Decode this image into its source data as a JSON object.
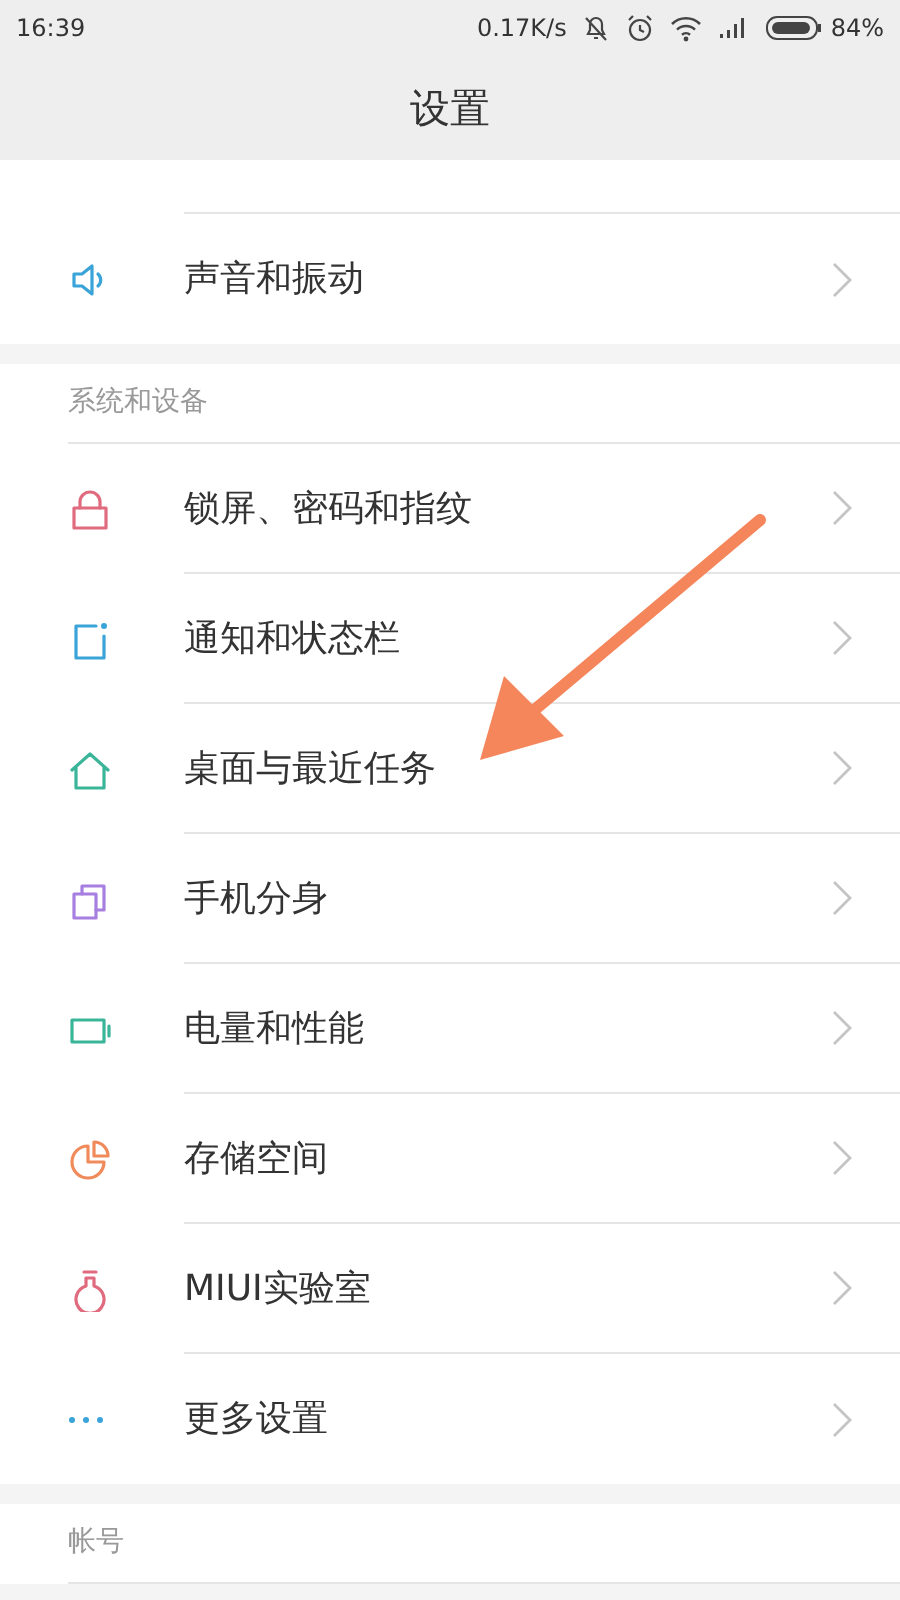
{
  "status_bar": {
    "time": "16:39",
    "speed": "0.17K/s",
    "battery": "84%"
  },
  "header": {
    "title": "设置"
  },
  "top_items": [
    {
      "label": "声音和振动",
      "kind": "sound",
      "color": "#3aa3d8"
    }
  ],
  "sections": [
    {
      "title": "系统和设备",
      "items": [
        {
          "label": "锁屏、密码和指纹",
          "kind": "lock",
          "color": "#e06a7e"
        },
        {
          "label": "通知和状态栏",
          "kind": "notify",
          "color": "#3aa3d8"
        },
        {
          "label": "桌面与最近任务",
          "kind": "home",
          "color": "#3bb59a"
        },
        {
          "label": "手机分身",
          "kind": "clone",
          "color": "#a77fe0"
        },
        {
          "label": "电量和性能",
          "kind": "battery",
          "color": "#3bb59a"
        },
        {
          "label": "存储空间",
          "kind": "storage",
          "color": "#f08a5a"
        },
        {
          "label": "MIUI实验室",
          "kind": "lab",
          "color": "#e06a7e"
        },
        {
          "label": "更多设置",
          "kind": "more",
          "color": "#3aa3d8"
        }
      ]
    },
    {
      "title": "帐号"
    }
  ]
}
